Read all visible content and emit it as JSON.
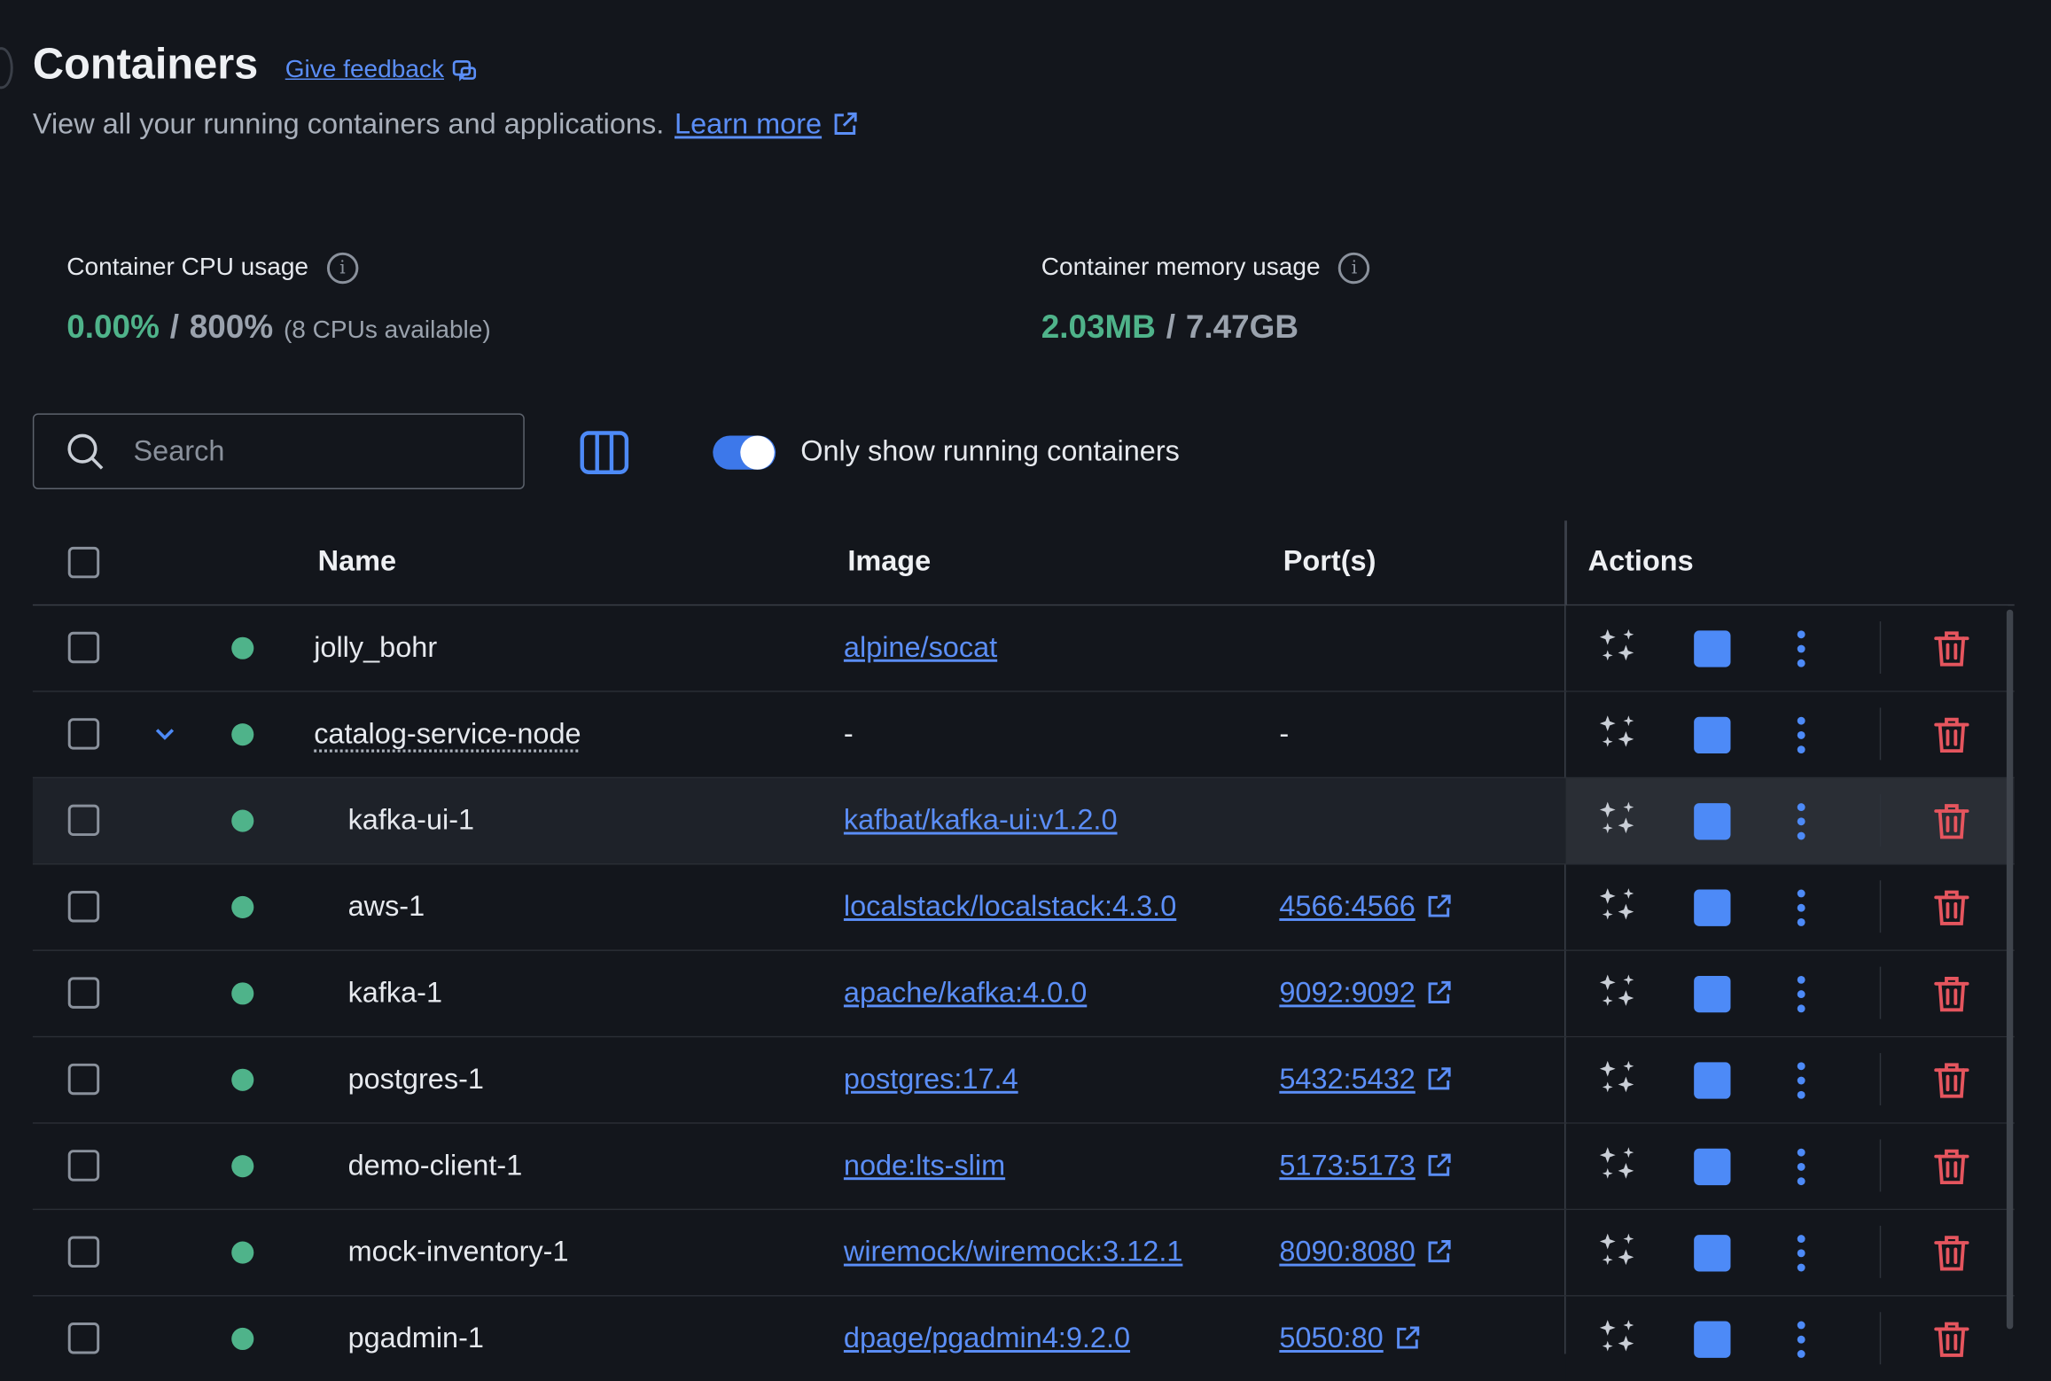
{
  "header": {
    "title": "Containers",
    "feedback_label": "Give feedback",
    "subtitle": "View all your running containers and applications.",
    "learn_more_label": "Learn more"
  },
  "stats": {
    "cpu": {
      "label": "Container CPU usage",
      "used": "0.00%",
      "sep": "/",
      "total": "800%",
      "note": "(8 CPUs available)"
    },
    "memory": {
      "label": "Container memory usage",
      "used": "2.03MB",
      "sep": "/",
      "total": "7.47GB"
    }
  },
  "toolbar": {
    "search_placeholder": "Search",
    "toggle_label": "Only show running containers",
    "toggle_on": true
  },
  "table": {
    "columns": {
      "name": "Name",
      "image": "Image",
      "ports": "Port(s)",
      "actions": "Actions"
    },
    "rows": [
      {
        "name": "jolly_bohr",
        "image": "alpine/socat",
        "port": ""
      },
      {
        "name": "catalog-service-node",
        "image": "-",
        "port": "-"
      },
      {
        "name": "kafka-ui-1",
        "image": "kafbat/kafka-ui:v1.2.0",
        "port": ""
      },
      {
        "name": "aws-1",
        "image": "localstack/localstack:4.3.0",
        "port": "4566:4566"
      },
      {
        "name": "kafka-1",
        "image": "apache/kafka:4.0.0",
        "port": "9092:9092"
      },
      {
        "name": "postgres-1",
        "image": "postgres:17.4",
        "port": "5432:5432"
      },
      {
        "name": "demo-client-1",
        "image": "node:lts-slim",
        "port": "5173:5173"
      },
      {
        "name": "mock-inventory-1",
        "image": "wiremock/wiremock:3.12.1",
        "port": "8090:8080"
      },
      {
        "name": "pgadmin-1",
        "image": "dpage/pgadmin4:9.2.0",
        "port": "5050:80"
      }
    ]
  },
  "colors": {
    "accent": "#4d8af7",
    "running": "#4fb38a",
    "danger": "#e5555e",
    "background": "#13161c"
  },
  "icons": [
    "feedback-icon",
    "external-link-icon",
    "info-icon",
    "search-icon",
    "columns-icon",
    "chevron-down-icon",
    "ai-sparkle-icon",
    "stop-icon",
    "kebab-menu-icon",
    "trash-icon"
  ]
}
